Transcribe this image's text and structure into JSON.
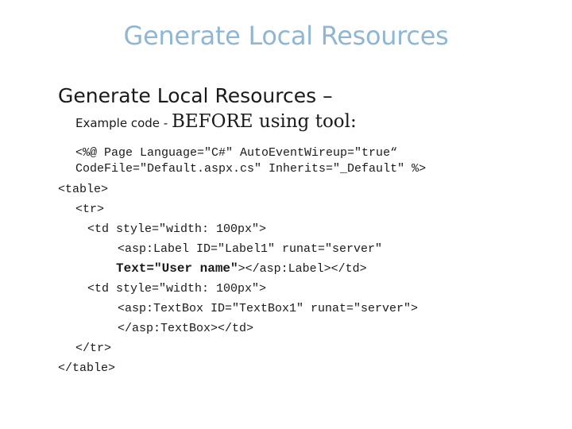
{
  "slide": {
    "title": "Generate Local Resources",
    "heading": "Generate Local Resources –",
    "subheading_small": "Example code - ",
    "subheading_large": "BEFORE using tool:"
  },
  "code": {
    "line1": "<%@ Page Language=\"C#\" AutoEventWireup=\"true“",
    "line2": "CodeFile=\"Default.aspx.cs\" Inherits=\"_Default\" %>",
    "line3": "<table>",
    "line4": "<tr>",
    "line5": "<td style=\"width: 100px\">",
    "line6": "<asp:Label ID=\"Label1\" runat=\"server\"",
    "line7_bold": "Text=\"User name\"",
    "line7_rest": "></asp:Label></td>",
    "line8": "<td style=\"width: 100px\">",
    "line9": "<asp:TextBox ID=\"TextBox1\" runat=\"server\">",
    "line10": "</asp:TextBox></td>",
    "line11": "</tr>",
    "line12": "</table>"
  }
}
